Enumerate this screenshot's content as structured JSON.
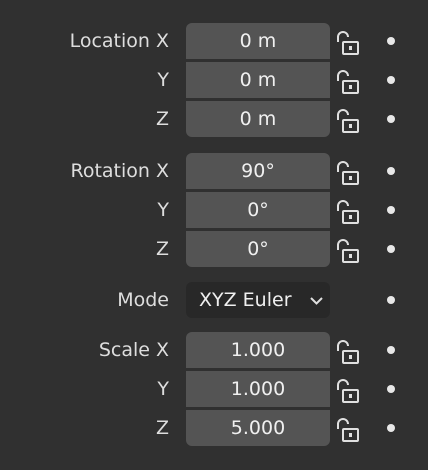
{
  "location": {
    "label": "Location X",
    "y_label": "Y",
    "z_label": "Z",
    "x": "0 m",
    "y": "0 m",
    "z": "0 m"
  },
  "rotation": {
    "label": "Rotation X",
    "y_label": "Y",
    "z_label": "Z",
    "x": "90°",
    "y": "0°",
    "z": "0°"
  },
  "mode": {
    "label": "Mode",
    "value": "XYZ Euler"
  },
  "scale": {
    "label": "Scale X",
    "y_label": "Y",
    "z_label": "Z",
    "x": "1.000",
    "y": "1.000",
    "z": "5.000"
  },
  "icons": {
    "lock": "unlocked-padlock-icon",
    "keyframe": "keyframe-dot-icon",
    "dropdown": "chevron-down-icon"
  },
  "colors": {
    "background": "#303030",
    "field": "#545454",
    "dropdown": "#282828",
    "text": "#e6e6e6"
  }
}
